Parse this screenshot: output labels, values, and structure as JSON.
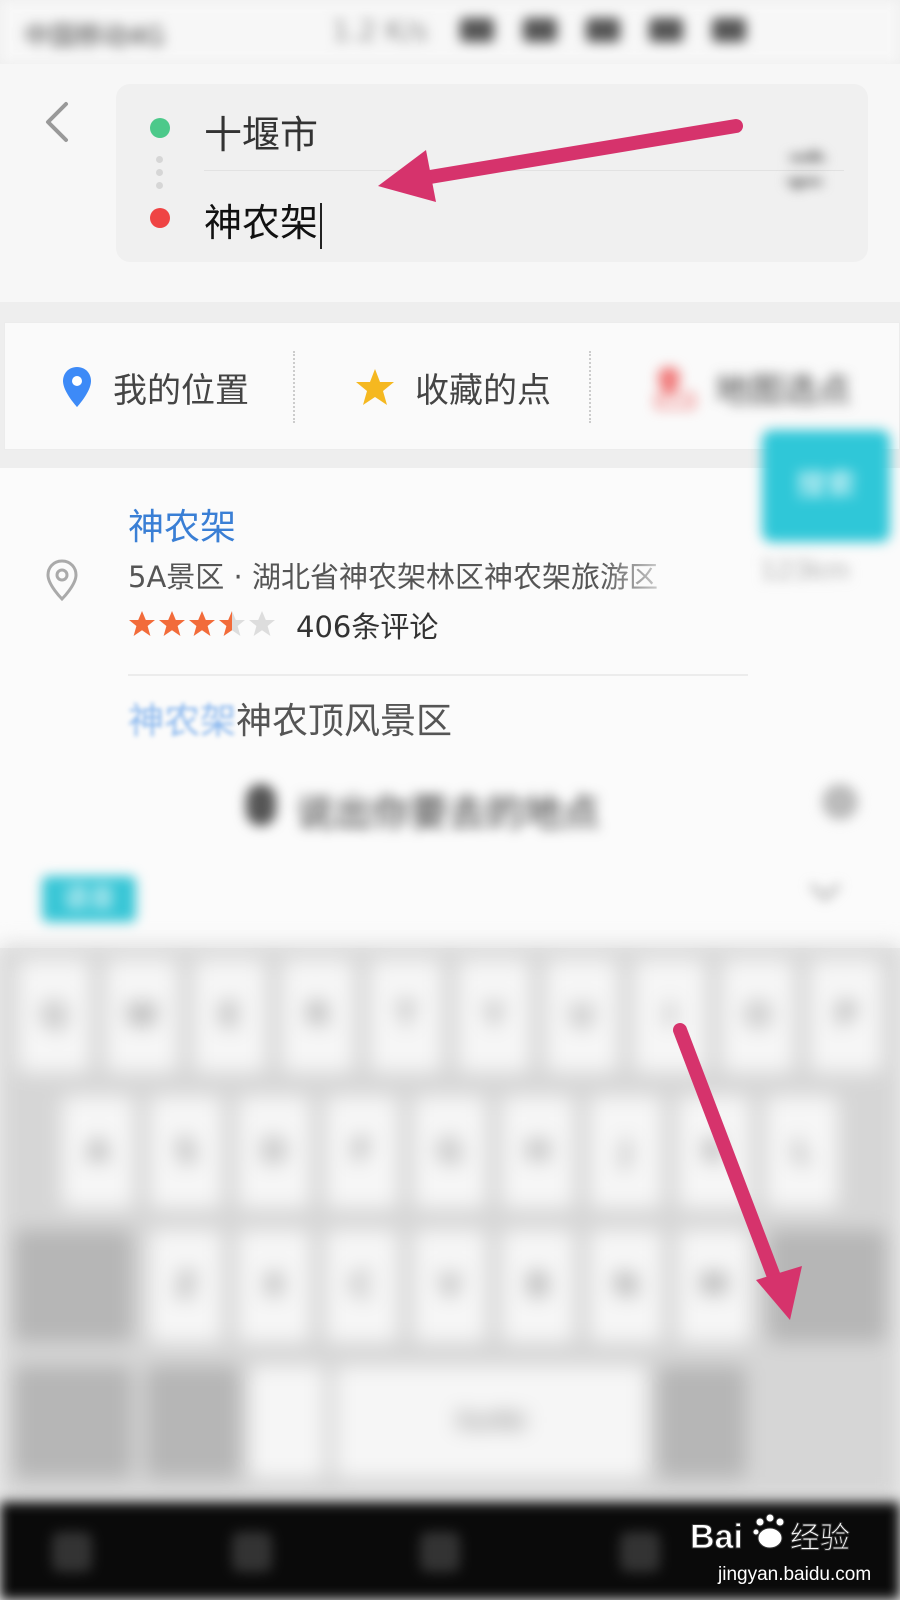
{
  "status_bar": {
    "carrier": "中国移动4G",
    "speed": "1.2 K/s"
  },
  "route": {
    "start_value": "十堰市",
    "end_value": "神农架"
  },
  "shortcuts": [
    {
      "label": "我的位置",
      "icon": "location-pin-icon",
      "color": "#3d8af7"
    },
    {
      "label": "收藏的点",
      "icon": "star-icon",
      "color": "#f5b820"
    },
    {
      "label": "地图选点",
      "icon": "map-pick-icon",
      "color": "#f07a7a"
    }
  ],
  "results": [
    {
      "title": "神农架",
      "description": "5A景区 · 湖北省神农架林区神农架旅游区",
      "distance": "123km",
      "rating": 3.5,
      "reviews": "406条评论"
    },
    {
      "title_highlight": "神农架",
      "title_rest": "神农顶风景区"
    }
  ],
  "voice_bar": {
    "prompt": "说出你要去的地点"
  },
  "keyboard": {
    "badge": "语音",
    "rows": [
      [
        "Q",
        "W",
        "E",
        "R",
        "T",
        "Y",
        "U",
        "I",
        "O",
        "P"
      ],
      [
        "A",
        "S",
        "D",
        "F",
        "G",
        "H",
        "J",
        "K",
        "L"
      ],
      [
        "Z",
        "X",
        "C",
        "V",
        "B",
        "N",
        "M"
      ]
    ],
    "space_label": "Xunfei",
    "enter_label": "搜索"
  },
  "watermark": {
    "brand": "Bai 经验",
    "url": "jingyan.baidu.com"
  },
  "colors": {
    "accent_blue": "#3a7fd5",
    "start_dot": "#4cc98a",
    "end_dot": "#ef4444",
    "annotation_arrow": "#d6336c",
    "enter_key": "#2fc7d8"
  }
}
